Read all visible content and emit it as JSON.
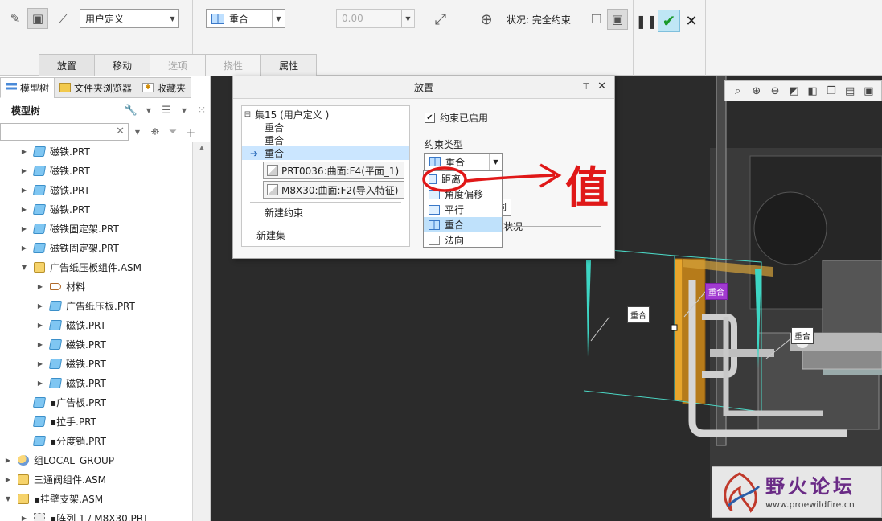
{
  "ribbon": {
    "type_combo": "用户定义",
    "constraint_combo": "重合",
    "offset_value": "0.00",
    "status": "状况: 完全约束",
    "tabs": [
      {
        "label": "放置",
        "state": "active"
      },
      {
        "label": "移动",
        "state": "normal"
      },
      {
        "label": "选项",
        "state": "disabled"
      },
      {
        "label": "挠性",
        "state": "disabled"
      },
      {
        "label": "属性",
        "state": "normal"
      }
    ]
  },
  "left_panel": {
    "nav_tabs": [
      "模型树",
      "文件夹浏览器",
      "收藏夹"
    ],
    "tree_title": "模型树",
    "items": [
      {
        "label": "磁铁.PRT",
        "type": "prt",
        "level": 1,
        "caret": "▶"
      },
      {
        "label": "磁铁.PRT",
        "type": "prt",
        "level": 1,
        "caret": "▶"
      },
      {
        "label": "磁铁.PRT",
        "type": "prt",
        "level": 1,
        "caret": "▶"
      },
      {
        "label": "磁铁.PRT",
        "type": "prt",
        "level": 1,
        "caret": "▶"
      },
      {
        "label": "磁铁固定架.PRT",
        "type": "prt",
        "level": 1,
        "caret": "▶"
      },
      {
        "label": "磁铁固定架.PRT",
        "type": "prt",
        "level": 1,
        "caret": "▶"
      },
      {
        "label": "广告纸压板组件.ASM",
        "type": "asm",
        "level": 1,
        "caret": "▼"
      },
      {
        "label": "材料",
        "type": "mat",
        "level": 2,
        "caret": "▶"
      },
      {
        "label": "广告纸压板.PRT",
        "type": "prt",
        "level": 2,
        "caret": "▶"
      },
      {
        "label": "磁铁.PRT",
        "type": "prt",
        "level": 2,
        "caret": "▶"
      },
      {
        "label": "磁铁.PRT",
        "type": "prt",
        "level": 2,
        "caret": "▶"
      },
      {
        "label": "磁铁.PRT",
        "type": "prt",
        "level": 2,
        "caret": "▶"
      },
      {
        "label": "磁铁.PRT",
        "type": "prt",
        "level": 2,
        "caret": "▶"
      },
      {
        "label": "▪广告板.PRT",
        "type": "prt",
        "level": 1,
        "caret": ""
      },
      {
        "label": "▪拉手.PRT",
        "type": "prt",
        "level": 1,
        "caret": ""
      },
      {
        "label": "▪分度销.PRT",
        "type": "prt",
        "level": 1,
        "caret": ""
      },
      {
        "label": "组LOCAL_GROUP",
        "type": "grp",
        "level": 0,
        "caret": "▶"
      },
      {
        "label": "三通阀组件.ASM",
        "type": "asm",
        "level": 0,
        "caret": "▶"
      },
      {
        "label": "▪挂壁支架.ASM",
        "type": "asm",
        "level": 0,
        "caret": "▼"
      },
      {
        "label": "▪阵列 1 / M8X30.PRT",
        "type": "pat",
        "level": 1,
        "caret": "▶"
      }
    ]
  },
  "dialog": {
    "title": "放置",
    "set_tree": {
      "set_label": "集15 (用户定义 )",
      "constraints": [
        "重合",
        "重合",
        "重合"
      ],
      "refs": [
        "PRT0036:曲面:F4(平面_1)",
        "M8X30:曲面:F2(导入特征)"
      ],
      "new_constraint": "新建约束",
      "new_set": "新建集"
    },
    "enabled_label": "约束已启用",
    "constraint_type_label": "约束类型",
    "selected_type": "重合",
    "dropdown_options": [
      "距离",
      "角度偏移",
      "平行",
      "重合",
      "法向"
    ],
    "selected_option_index": 3,
    "behind_input_text": "同",
    "behind_status_text": "状况"
  },
  "canvas": {
    "tags": [
      "重合",
      "重合",
      "重合"
    ]
  },
  "annotation": {
    "handwritten_text": "值",
    "color": "#e01818"
  },
  "watermark": {
    "title": "野火论坛",
    "url": "www.proewildfire.cn"
  }
}
